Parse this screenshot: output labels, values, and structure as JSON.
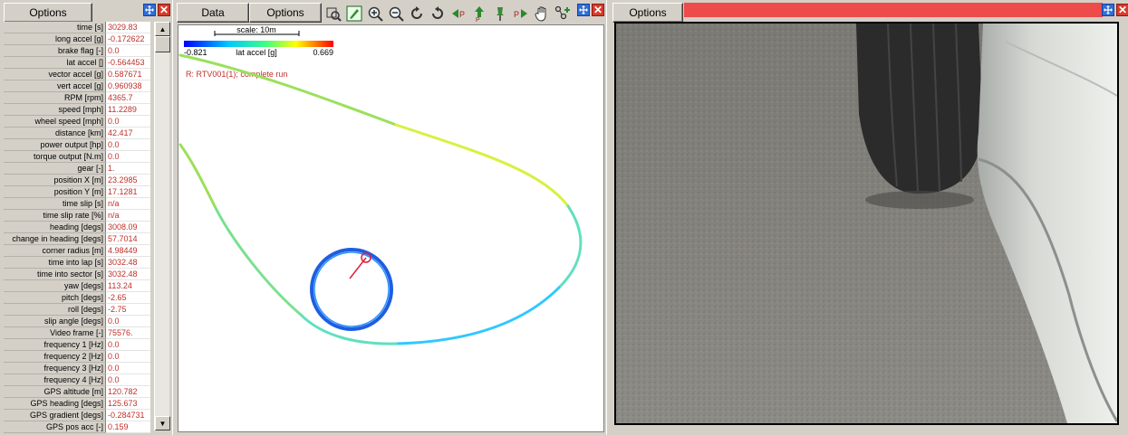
{
  "left_panel": {
    "options_label": "Options",
    "channels": [
      {
        "label": "time [s]",
        "value": "3029.83"
      },
      {
        "label": "long accel [g]",
        "value": "-0.172622"
      },
      {
        "label": "brake flag [-]",
        "value": "0.0"
      },
      {
        "label": "lat accel []",
        "value": "-0.564453"
      },
      {
        "label": "vector accel [g]",
        "value": "0.587671"
      },
      {
        "label": "vert accel [g]",
        "value": "0.960938"
      },
      {
        "label": "RPM [rpm]",
        "value": "4365.7"
      },
      {
        "label": "speed [mph]",
        "value": "11.2289"
      },
      {
        "label": "wheel speed [mph]",
        "value": "0.0"
      },
      {
        "label": "distance [km]",
        "value": "42.417"
      },
      {
        "label": "power output [hp]",
        "value": "0.0"
      },
      {
        "label": "torque output [N.m]",
        "value": "0.0"
      },
      {
        "label": "gear [-]",
        "value": "1."
      },
      {
        "label": "position X [m]",
        "value": "23.2985"
      },
      {
        "label": "position Y [m]",
        "value": "17.1281"
      },
      {
        "label": "time slip [s]",
        "value": "n/a"
      },
      {
        "label": "time slip rate [%]",
        "value": "n/a"
      },
      {
        "label": "heading [degs]",
        "value": "3008.09"
      },
      {
        "label": "change in heading [degs]",
        "value": "57.7014"
      },
      {
        "label": "corner radius [m]",
        "value": "4.98449"
      },
      {
        "label": "time into lap [s]",
        "value": "3032.48"
      },
      {
        "label": "time into sector [s]",
        "value": "3032.48"
      },
      {
        "label": "yaw [degs]",
        "value": "113.24"
      },
      {
        "label": "pitch  [degs]",
        "value": "-2.65"
      },
      {
        "label": "roll [degs]",
        "value": "-2.75"
      },
      {
        "label": "slip angle [degs]",
        "value": "0.0"
      },
      {
        "label": "Video frame [-]",
        "value": "75576."
      },
      {
        "label": "frequency 1 [Hz]",
        "value": "0.0"
      },
      {
        "label": "frequency 2 [Hz]",
        "value": "0.0"
      },
      {
        "label": "frequency 3 [Hz]",
        "value": "0.0"
      },
      {
        "label": "frequency 4 [Hz]",
        "value": "0.0"
      },
      {
        "label": "GPS altitude [m]",
        "value": "120.782"
      },
      {
        "label": "GPS heading [degs]",
        "value": "125.673"
      },
      {
        "label": "GPS gradient [degs]",
        "value": "-0.284731"
      },
      {
        "label": "GPS pos acc [-]",
        "value": "0.159"
      }
    ]
  },
  "map_panel": {
    "data_label": "Data",
    "options_label": "Options",
    "scale_label": "scale: 10m",
    "colorbar_min": "-0.821",
    "colorbar_max": "0.669",
    "colorbar_title": "lat accel [g]",
    "run_label": "R:  RTV001(1); complete run",
    "tools": [
      "zoom-box-icon",
      "pen-icon",
      "zoom-in-icon",
      "zoom-out-icon",
      "rotate-cw-icon",
      "rotate-ccw-icon",
      "step-back-icon",
      "up-arrow-icon",
      "pin-icon",
      "step-forward-icon",
      "hand-icon",
      "node-add-icon"
    ],
    "colors": {
      "low": "#0000ff",
      "mid": "#00ff80",
      "high": "#ff0000",
      "marker": "#e0203a"
    }
  },
  "video_panel": {
    "options_label": "Options",
    "bar_color": "#ee4b4b"
  }
}
